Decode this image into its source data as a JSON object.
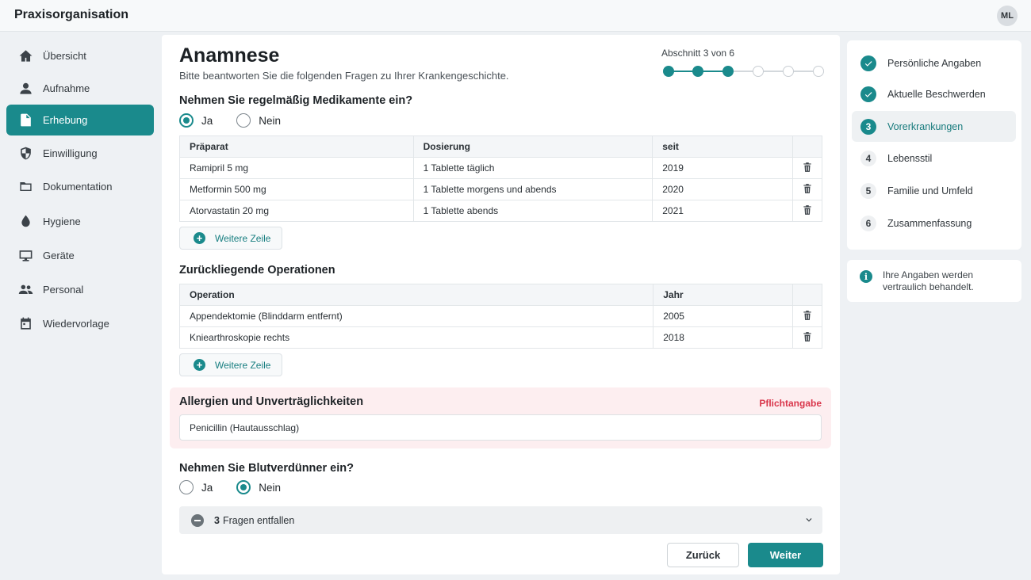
{
  "app": {
    "title": "Praxisorganisation",
    "user_initials": "ML"
  },
  "sidebar": {
    "items": [
      {
        "label": "Übersicht",
        "icon": "home-icon",
        "active": false
      },
      {
        "label": "Aufnahme",
        "icon": "person-icon",
        "active": false
      },
      {
        "label": "Erhebung",
        "icon": "document-icon",
        "active": true
      },
      {
        "label": "Einwilligung",
        "icon": "shield-icon",
        "active": false
      },
      {
        "label": "Dokumentation",
        "icon": "folder-icon",
        "active": false
      },
      {
        "label": "Hygiene",
        "icon": "drop-icon",
        "active": false
      },
      {
        "label": "Geräte",
        "icon": "monitor-icon",
        "active": false
      },
      {
        "label": "Personal",
        "icon": "people-icon",
        "active": false
      },
      {
        "label": "Wiedervorlage",
        "icon": "calendar-icon",
        "active": false
      }
    ]
  },
  "form": {
    "title": "Anamnese",
    "subtitle": "Bitte beantworten Sie die folgenden Fragen zu Ihrer Krankengeschichte.",
    "progress": {
      "label": "Abschnitt 3 von 6",
      "current": 3,
      "total": 6
    },
    "medications": {
      "question": "Nehmen Sie regelmäßig Medikamente ein?",
      "options": [
        "Ja",
        "Nein"
      ],
      "selected": "Ja",
      "columns": [
        "Präparat",
        "Dosierung",
        "seit"
      ],
      "rows": [
        [
          "Ramipril 5 mg",
          "1 Tablette täglich",
          "2019"
        ],
        [
          "Metformin 500 mg",
          "1 Tablette morgens und abends",
          "2020"
        ],
        [
          "Atorvastatin 20 mg",
          "1 Tablette abends",
          "2021"
        ]
      ],
      "add_label": "Weitere Zeile"
    },
    "operations": {
      "question": "Zurückliegende Operationen",
      "columns": [
        "Operation",
        "Jahr"
      ],
      "rows": [
        [
          "Appendektomie (Blinddarm entfernt)",
          "2005"
        ],
        [
          "Kniearthroskopie rechts",
          "2018"
        ]
      ],
      "add_label": "Weitere Zeile"
    },
    "allergies": {
      "question": "Allergien und Unverträglichkeiten",
      "required_label": "Pflichtangabe",
      "value": "Penicillin (Hautausschlag)"
    },
    "anticoagulants": {
      "question": "Nehmen Sie Blutverdünner ein?",
      "options": [
        "Ja",
        "Nein"
      ],
      "selected": "Nein"
    },
    "skipped": {
      "count": "3",
      "label": "Fragen entfallen"
    },
    "buttons": {
      "back": "Zurück",
      "next": "Weiter"
    }
  },
  "steps": [
    {
      "number": "1",
      "label": "Persönliche Angaben",
      "state": "done"
    },
    {
      "number": "2",
      "label": "Aktuelle Beschwerden",
      "state": "done"
    },
    {
      "number": "3",
      "label": "Vorerkrankungen",
      "state": "current"
    },
    {
      "number": "4",
      "label": "Lebensstil",
      "state": "todo"
    },
    {
      "number": "5",
      "label": "Familie und Umfeld",
      "state": "todo"
    },
    {
      "number": "6",
      "label": "Zusammenfassung",
      "state": "todo"
    }
  ],
  "info": {
    "text": "Ihre Angaben werden vertraulich behandelt."
  },
  "colors": {
    "accent": "#1a8a8c",
    "required": "#d9364b",
    "required_bg": "#fdeef0"
  }
}
